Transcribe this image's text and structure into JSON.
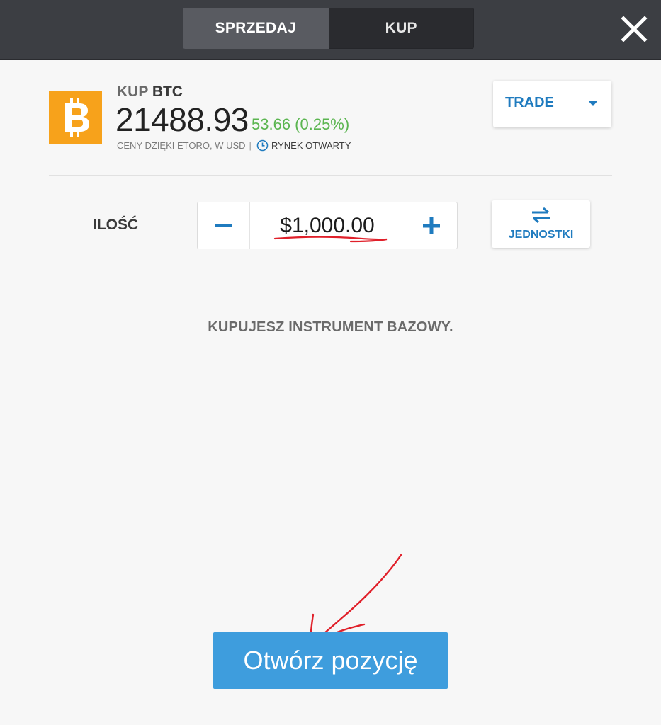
{
  "header": {
    "tabs": [
      {
        "label": "SPRZEDAJ",
        "active": true
      },
      {
        "label": "KUP",
        "active": false
      }
    ],
    "close_icon": "close-icon"
  },
  "instrument": {
    "action": "KUP",
    "symbol": "BTC",
    "logo_icon": "bitcoin-logo",
    "logo_color": "#f7a21b",
    "price": "21488.93",
    "change": "53.66 (0.25%)",
    "change_color": "#5bb550",
    "price_source": "CENY DZIĘKI ETORO, W USD",
    "separator": "|",
    "market_status": "RYNEK OTWARTY",
    "market_icon": "clock-icon"
  },
  "trade_dropdown": {
    "label": "TRADE",
    "icon": "caret-down-icon"
  },
  "amount": {
    "label": "ILOŚĆ",
    "value": "$1,000.00",
    "minus_icon": "minus-icon",
    "plus_icon": "plus-icon"
  },
  "units_button": {
    "label": "JEDNOSTKI",
    "icon": "swap-arrows-icon"
  },
  "info_text": "KUPUJESZ INSTRUMENT BAZOWY.",
  "open_button": {
    "label": "Otwórz pozycję",
    "color": "#3e9ddd"
  },
  "colors": {
    "accent": "#1f7bbf",
    "annotation": "#e0202a"
  }
}
